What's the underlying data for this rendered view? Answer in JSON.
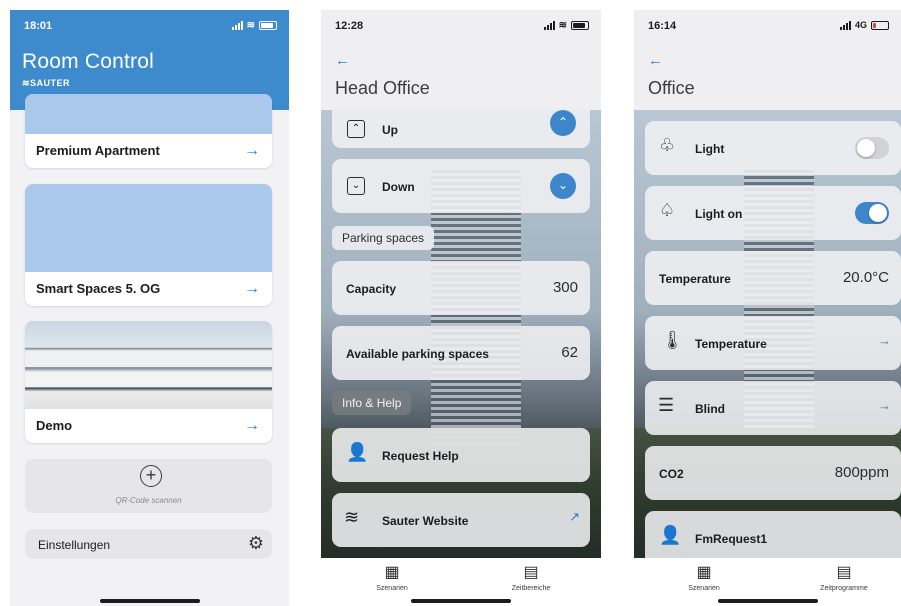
{
  "screen1": {
    "status": {
      "time": "18:01"
    },
    "app_title": "Room Control",
    "brand": "SAUTER",
    "spaces": [
      {
        "label": "Premium Apartment"
      },
      {
        "label": "Smart Spaces 5. OG"
      },
      {
        "label": "Demo"
      }
    ],
    "scan_label": "QR-Code scannen",
    "settings_label": "Einstellungen"
  },
  "screen2": {
    "status": {
      "time": "12:28"
    },
    "title": "Head Office",
    "up_label": "Up",
    "down_label": "Down",
    "parking_section": "Parking spaces",
    "capacity": {
      "label": "Capacity",
      "value": "300"
    },
    "available": {
      "label": "Available parking spaces",
      "value": "62"
    },
    "info_section": "Info & Help",
    "request_help": "Request Help",
    "website": "Sauter Website",
    "tabs": [
      "Szenarien",
      "Zeitbereiche"
    ]
  },
  "screen3": {
    "status": {
      "time": "16:14",
      "network": "4G"
    },
    "title": "Office",
    "light": {
      "label": "Light",
      "on": false
    },
    "light_on": {
      "label": "Light on",
      "on": true
    },
    "temperature_value": {
      "label": "Temperature",
      "value": "20.0°C"
    },
    "temperature_link": "Temperature",
    "blind": "Blind",
    "co2": {
      "label": "CO2",
      "value": "800ppm"
    },
    "fm_request": "FmRequest1",
    "tabs": [
      "Szenarien",
      "Zeitprogramme"
    ]
  },
  "colors": {
    "accent": "#3d86c9",
    "header": "#3d8bcc",
    "toggle_on": "#3d86c9",
    "toggle_off": "#d1d1d6"
  },
  "icons": {
    "back": "arrow-left-icon",
    "arrow": "arrow-right-icon",
    "gear": "gear-icon",
    "scan": "plus-circle-icon",
    "external": "external-link-icon"
  }
}
